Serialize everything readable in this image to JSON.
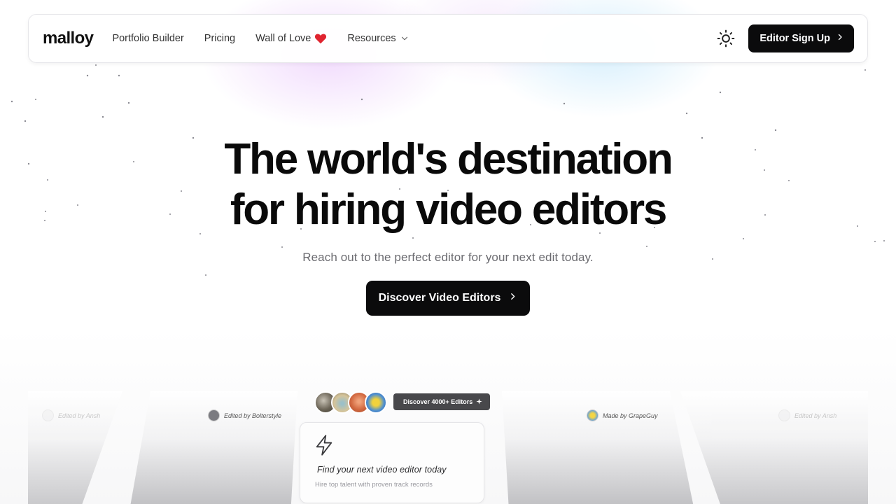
{
  "nav": {
    "logo": "malloy",
    "links": [
      "Portfolio Builder",
      "Pricing",
      "Wall of Love",
      "Resources"
    ],
    "signup_label": "Editor Sign Up"
  },
  "hero": {
    "title_line1": "The world's destination",
    "title_line2": "for hiring video editors",
    "subtitle": "Reach out to the perfect editor for your next edit today.",
    "cta_label": "Discover Video Editors"
  },
  "showcase": {
    "panels": [
      {
        "tag": "Edited by Ansh"
      },
      {
        "tag": "Edited by Bolterstyle"
      },
      {
        "tag": "Made by GrapeGuy"
      },
      {
        "tag": "Edited by Ansh"
      }
    ],
    "badge_label": "Discover 4000+ Editors",
    "card_title": "Find your next video editor today",
    "card_subtitle": "Hire top talent with proven track records"
  },
  "icons": {
    "wall_of_love": "heart-icon",
    "resources": "chevron-down-icon",
    "theme_toggle": "sun-icon",
    "signup": "chevron-right-icon",
    "cta": "chevron-right-icon",
    "badge": "sparkle-icon",
    "card": "bolt-icon"
  },
  "colors": {
    "primary": "#0b0b0c",
    "heart": "#e0242f",
    "badge": "#48484b",
    "muted_text": "#6b6b70"
  }
}
